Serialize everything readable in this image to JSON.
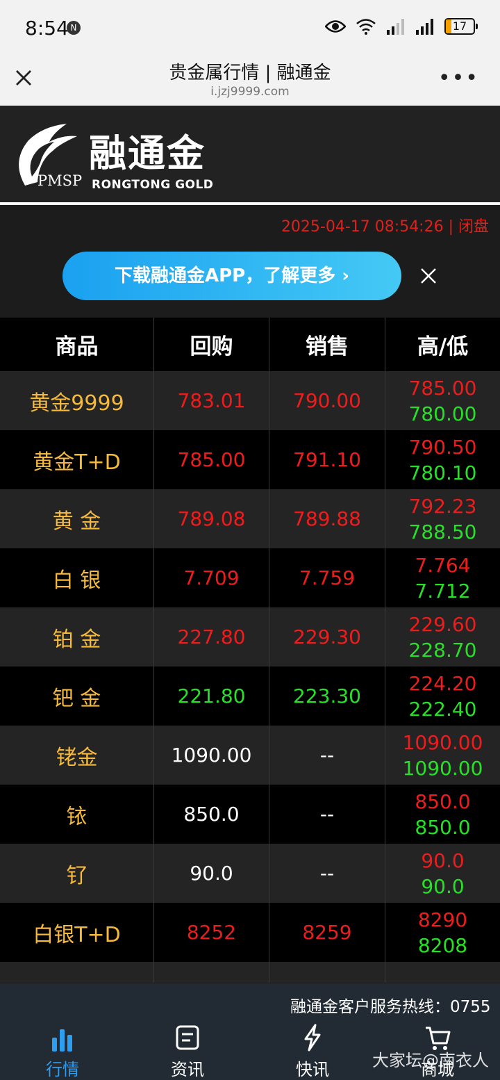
{
  "status": {
    "time": "8:54",
    "battery": "17"
  },
  "nav": {
    "title": "贵金属行情 | 融通金",
    "url": "i.jzj9999.com"
  },
  "logo": {
    "cn": "融通金",
    "en": "RONGTONG GOLD",
    "pmsp": "PMSP"
  },
  "datetime": "2025-04-17 08:54:26 | 闭盘",
  "banner": {
    "text": "下载融通金APP，了解更多  ›"
  },
  "table": {
    "headers": [
      "商品",
      "回购",
      "销售",
      "高/低"
    ],
    "rows": [
      {
        "name": "黄金9999",
        "buy": "783.01",
        "sell": "790.00",
        "high": "785.00",
        "low": "780.00"
      },
      {
        "name": "黄金T+D",
        "buy": "785.00",
        "sell": "791.10",
        "high": "790.50",
        "low": "780.10"
      },
      {
        "name": "黄 金",
        "buy": "789.08",
        "sell": "789.88",
        "high": "792.23",
        "low": "788.50"
      },
      {
        "name": "白 银",
        "buy": "7.709",
        "sell": "7.759",
        "high": "7.764",
        "low": "7.712"
      },
      {
        "name": "铂 金",
        "buy": "227.80",
        "sell": "229.30",
        "high": "229.60",
        "low": "228.70"
      },
      {
        "name": "钯 金",
        "buy": "221.80",
        "sell": "223.30",
        "high": "224.20",
        "low": "222.40"
      },
      {
        "name": "铑金",
        "buy": "1090.00",
        "sell": "--",
        "high": "1090.00",
        "low": "1090.00"
      },
      {
        "name": "铱",
        "buy": "850.0",
        "sell": "--",
        "high": "850.0",
        "low": "850.0"
      },
      {
        "name": "钌",
        "buy": "90.0",
        "sell": "--",
        "high": "90.0",
        "low": "90.0"
      },
      {
        "name": "白银T+D",
        "buy": "8252",
        "sell": "8259",
        "high": "8290",
        "low": "8208"
      }
    ]
  },
  "footer": {
    "hotline": "融通金客户服务热线：0755",
    "tabs": [
      "行情",
      "资讯",
      "快讯",
      "商城"
    ]
  },
  "watermark": "大家坛@南衣人",
  "colors": {
    "up": "#ee1d1d",
    "down": "#28e028",
    "name": "#f5b93b",
    "accent": "#2d9df0"
  }
}
